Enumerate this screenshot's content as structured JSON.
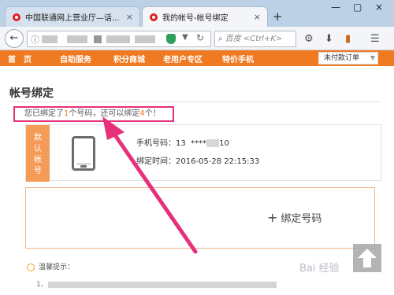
{
  "browser": {
    "tabs": [
      {
        "title": "中国联通网上营业厅—话...",
        "active": false
      },
      {
        "title": "我的帐号-帐号绑定",
        "active": true
      }
    ],
    "new_tab": "+",
    "close": "×",
    "win_controls": [
      "—",
      "▢",
      "×"
    ],
    "search_placeholder": "百度 <Ctrl+K>"
  },
  "site_nav": {
    "items": [
      "首　页",
      "自助服务",
      "积分商城",
      "老用户专区",
      "特价手机"
    ],
    "dropdown": "未付款订单"
  },
  "page": {
    "title": "帐号绑定",
    "notice_prefix": "您已绑定了",
    "bound_count": "1",
    "notice_mid": "个号码，还可以绑定",
    "remaining_count": "4",
    "notice_suffix": "个！"
  },
  "card": {
    "badge": "默认帐号",
    "phone_label": "手机号码：",
    "phone_prefix": "13",
    "phone_masked": "****",
    "phone_suffix": "10",
    "bind_time_label": "绑定时间：",
    "bind_time": "2016-05-28 22:15:33"
  },
  "add_binding": {
    "plus": "+",
    "label": "绑定号码"
  },
  "tips": {
    "title": "温馨提示：",
    "line": "1、"
  },
  "watermark": "Bai 经验",
  "colors": {
    "brand_orange": "#f07a22",
    "highlight_pink": "#e6307a",
    "badge_orange": "#f49b57"
  }
}
